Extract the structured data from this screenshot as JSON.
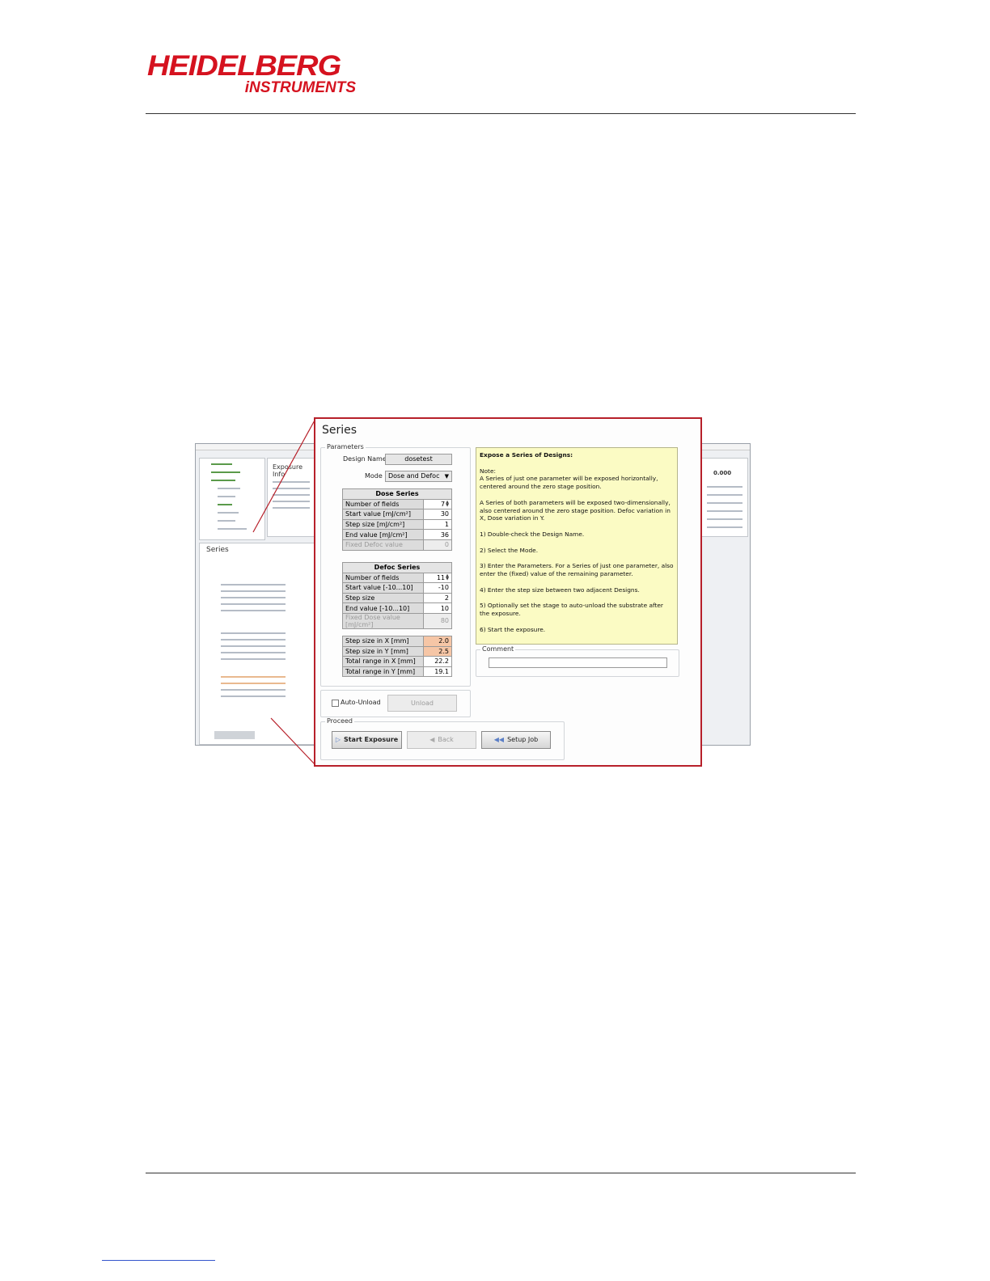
{
  "logo": {
    "line1": "HEIDELBERG",
    "line2": "iNSTRUMENTS"
  },
  "series": {
    "title": "Series",
    "parameters_label": "Parameters",
    "design_name_label": "Design Name",
    "design_name_value": "dosetest",
    "mode_label": "Mode",
    "mode_value": "Dose and Defoc",
    "dose_series": {
      "header": "Dose Series",
      "rows": [
        {
          "label": "Number of fields",
          "value": "7"
        },
        {
          "label": "Start value [mJ/cm²]",
          "value": "30"
        },
        {
          "label": "Step size [mJ/cm²]",
          "value": "1"
        },
        {
          "label": "End value [mJ/cm²]",
          "value": "36"
        },
        {
          "label": "Fixed Defoc value",
          "value": "0"
        }
      ]
    },
    "defoc_series": {
      "header": "Defoc Series",
      "rows": [
        {
          "label": "Number of fields",
          "value": "11"
        },
        {
          "label": "Start value [-10...10]",
          "value": "-10"
        },
        {
          "label": "Step size",
          "value": "2"
        },
        {
          "label": "End value [-10...10]",
          "value": "10"
        },
        {
          "label": "Fixed Dose value [mJ/cm²]",
          "value": "80"
        }
      ]
    },
    "steps": {
      "rows": [
        {
          "label": "Step size in X [mm]",
          "value": "2.0"
        },
        {
          "label": "Step size in Y [mm]",
          "value": "2.5"
        },
        {
          "label": "Total range in X [mm]",
          "value": "22.2"
        },
        {
          "label": "Total range in Y [mm]",
          "value": "19.1"
        }
      ]
    },
    "auto_unload_label": "Auto-Unload",
    "unload_button": "Unload",
    "proceed_label": "Proceed",
    "start_exposure_button": "Start Exposure",
    "back_button": "Back",
    "setup_job_button": "Setup Job",
    "comment_label": "Comment",
    "help": {
      "heading": "Expose a Series of Designs:",
      "note_label": "Note:",
      "paragraphs": [
        "A Series of just one parameter will be exposed horizontally, centered around the zero stage position.",
        "A Series of both parameters will be exposed two-dimensionally, also centered around the zero stage position. Defoc variation in X, Dose variation in Y.",
        "1) Double-check the Design Name.",
        "2) Select the Mode.",
        "3) Enter the Parameters. For a Series of just one parameter, also enter the (fixed) value of the remaining parameter.",
        "4) Enter the step size between two adjacent Designs.",
        "5) Optionally set the stage to auto-unload the substrate after the exposure.",
        "6) Start the exposure."
      ]
    }
  },
  "thumbnail": {
    "exposure_info": "Exposure Info",
    "series": "Series",
    "top_right_value": "0.000"
  },
  "colors": {
    "brand_red": "#d5121f",
    "frame_red": "#b7202a",
    "help_bg": "#fbfbc4",
    "highlight": "#f6c6a6"
  }
}
